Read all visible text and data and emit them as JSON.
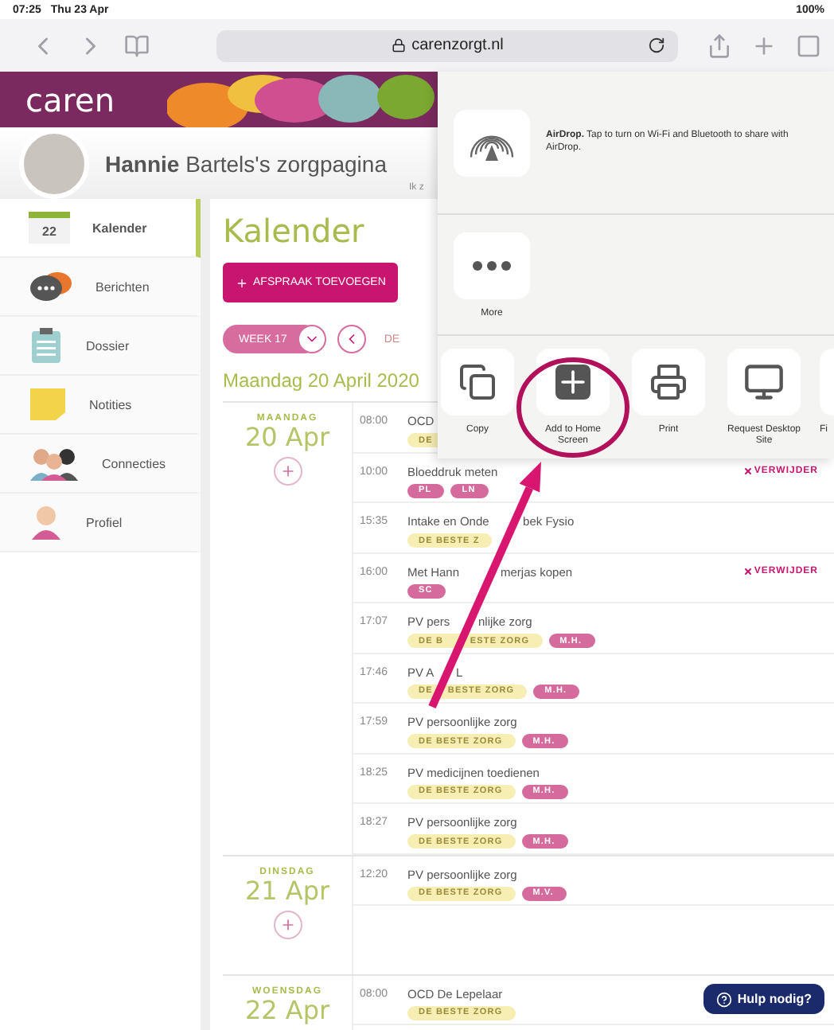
{
  "status_bar": {
    "time": "07:25",
    "date": "Thu 23 Apr",
    "battery": "100%"
  },
  "browser": {
    "url": "carenzorgt.nl"
  },
  "banner": {
    "logo": "caren"
  },
  "profile": {
    "title": "**Hannie** Bartels's zorgpagina",
    "partial_text": "Ik z"
  },
  "sidebar": {
    "items": [
      {
        "label": "Kalender",
        "selected": true,
        "badge": "22"
      },
      {
        "label": "Berichten",
        "selected": false
      },
      {
        "label": "Dossier",
        "selected": false
      },
      {
        "label": "Notities",
        "selected": false
      },
      {
        "label": "Connecties",
        "selected": false
      },
      {
        "label": "Profiel",
        "selected": false
      }
    ]
  },
  "calendar": {
    "title": "Kalender",
    "add_button": "AFSPRAAK TOEVOEGEN",
    "week": "WEEK 17",
    "week_partial": "DE",
    "date_heading": "Maandag 20 April 2020",
    "days": [
      {
        "weekday": "MAANDAG",
        "date": "20 Apr",
        "events": [
          {
            "time": "08:00",
            "title": "OCD",
            "tags": [
              {
                "label": "DE",
                "kind": "org"
              }
            ]
          },
          {
            "time": "10:00",
            "title": "Bloeddruk meten",
            "delete": "VERWIJDER",
            "tags": [
              {
                "label": "PL",
                "kind": "person"
              },
              {
                "label": "LN",
                "kind": "person"
              }
            ]
          },
          {
            "time": "15:35",
            "title": "Intake en Onde",
            "title_after": "bek Fysio",
            "tags": [
              {
                "label": "DE BESTE Z",
                "kind": "org"
              }
            ]
          },
          {
            "time": "16:00",
            "title": "Met Hann",
            "title_after": "merjas kopen",
            "delete": "VERWIJDER",
            "tags": [
              {
                "label": "SC",
                "kind": "person"
              }
            ]
          },
          {
            "time": "17:07",
            "title": "PV pers",
            "title_after": "nlijke zorg",
            "tags": [
              {
                "label": "DE B",
                "label_after": "ESTE ZORG",
                "kind": "org"
              },
              {
                "label": "M.H.",
                "kind": "person"
              }
            ]
          },
          {
            "time": "17:46",
            "title": "PV A",
            "title_after": "L",
            "tags": [
              {
                "label": "DE",
                "label_after": "BESTE ZORG",
                "kind": "org"
              },
              {
                "label": "M.H.",
                "kind": "person"
              }
            ]
          },
          {
            "time": "17:59",
            "title": "PV persoonlijke zorg",
            "tags": [
              {
                "label": "DE BESTE ZORG",
                "kind": "org"
              },
              {
                "label": "M.H.",
                "kind": "person"
              }
            ]
          },
          {
            "time": "18:25",
            "title": "PV medicijnen toedienen",
            "tags": [
              {
                "label": "DE BESTE ZORG",
                "kind": "org"
              },
              {
                "label": "M.H.",
                "kind": "person"
              }
            ]
          },
          {
            "time": "18:27",
            "title": "PV persoonlijke zorg",
            "tags": [
              {
                "label": "DE BESTE ZORG",
                "kind": "org"
              },
              {
                "label": "M.H.",
                "kind": "person"
              }
            ]
          }
        ]
      },
      {
        "weekday": "DINSDAG",
        "date": "21 Apr",
        "events": [
          {
            "time": "12:20",
            "title": "PV persoonlijke zorg",
            "tags": [
              {
                "label": "DE BESTE ZORG",
                "kind": "org"
              },
              {
                "label": "M.V.",
                "kind": "person"
              }
            ]
          }
        ]
      },
      {
        "weekday": "WOENSDAG",
        "date": "22 Apr",
        "events": [
          {
            "time": "08:00",
            "title": "OCD De Lepelaar",
            "tags": [
              {
                "label": "DE BESTE ZORG",
                "kind": "org"
              }
            ]
          }
        ]
      }
    ]
  },
  "help_button": "Hulp nodig?",
  "share_sheet": {
    "airdrop": "**AirDrop.** Tap to turn on Wi-Fi and Bluetooth to share with AirDrop.",
    "more": "More",
    "actions": [
      {
        "kind": "copy",
        "label": "Copy",
        "highlighted": false
      },
      {
        "kind": "add",
        "label": "Add to Home Screen",
        "highlighted": true
      },
      {
        "kind": "print",
        "label": "Print",
        "highlighted": false
      },
      {
        "kind": "desktop",
        "label": "Request Desktop Site",
        "highlighted": false
      },
      {
        "kind": "partial",
        "label": "Fi",
        "highlighted": false
      }
    ]
  }
}
